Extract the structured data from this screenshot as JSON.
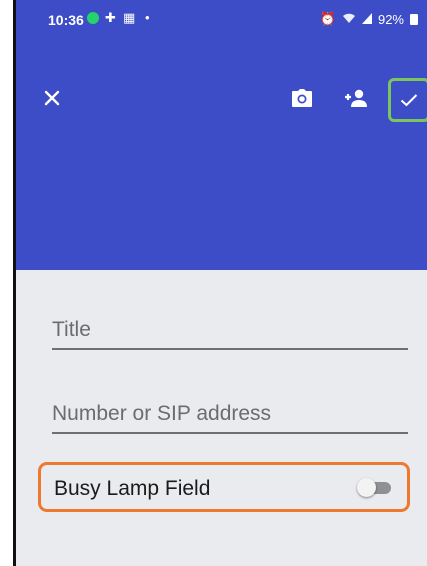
{
  "status_bar": {
    "time": "10:36",
    "battery_text": "92%",
    "icons": [
      "green-dot-icon",
      "slack-icon",
      "calendar-icon",
      "notification-dot-icon",
      "alarm-icon",
      "wifi-icon",
      "signal-icon",
      "battery-icon"
    ]
  },
  "toolbar": {
    "close_icon": "close-icon",
    "camera_icon": "camera-icon",
    "add_contact_icon": "add-contact-icon",
    "save_icon": "check-icon"
  },
  "form": {
    "title_placeholder": "Title",
    "title_value": "",
    "number_placeholder": "Number or SIP address",
    "number_value": "",
    "blf_label": "Busy Lamp Field",
    "blf_enabled": false
  },
  "colors": {
    "app_bar": "#3d4dc8",
    "body_bg": "#e9ebee",
    "save_highlight": "#7cc45c",
    "blf_highlight": "#ec7a2e"
  }
}
